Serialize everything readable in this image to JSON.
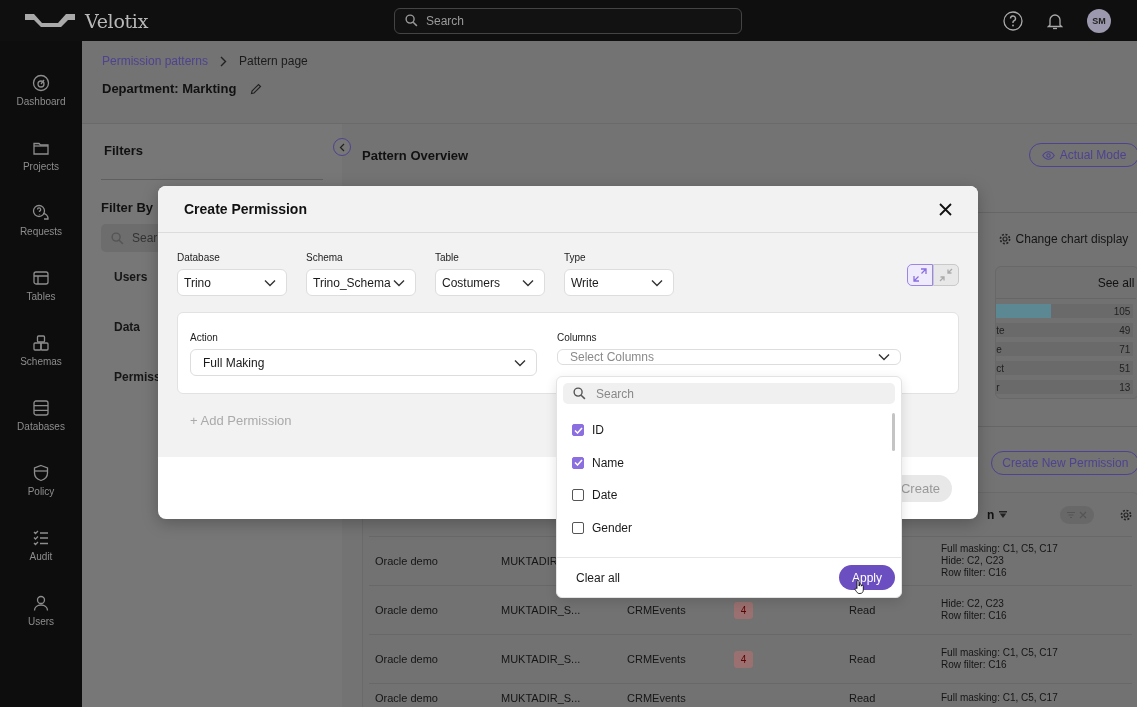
{
  "topbar": {
    "brand": "Velotix",
    "search": {
      "placeholder": "Search"
    },
    "avatar": "SM"
  },
  "sidebar": {
    "items": [
      {
        "label": "Dashboard"
      },
      {
        "label": "Projects"
      },
      {
        "label": "Requests"
      },
      {
        "label": "Tables"
      },
      {
        "label": "Schemas"
      },
      {
        "label": "Databases"
      },
      {
        "label": "Policy"
      },
      {
        "label": "Audit"
      },
      {
        "label": "Users"
      }
    ]
  },
  "breadcrumb": [
    {
      "label": "Permission patterns",
      "current": false
    },
    {
      "label": "Pattern page",
      "current": true
    }
  ],
  "page_title": "Department: Markting",
  "filters": {
    "title": "Filters",
    "filter_by": "Filter By",
    "search": {
      "placeholder": "Sear"
    },
    "groups": [
      "Users",
      "Data",
      "Permiss"
    ]
  },
  "overview": {
    "title": "Pattern Overview",
    "mode_button": "Actual Mode",
    "chart_display": "Change chart display",
    "chart_card": {
      "see_all": "See all",
      "rows": [
        {
          "value": "105",
          "level": 0.4
        },
        {
          "label": "te",
          "value": "49"
        },
        {
          "label": "e",
          "value": "71"
        },
        {
          "label": "ct",
          "value": "51"
        },
        {
          "label": "r",
          "value": "13"
        }
      ]
    },
    "create_button": "Create New Permission",
    "table": {
      "header": "n",
      "rows": [
        {
          "cells": [
            "Oracle demo",
            "MUKTADIR"
          ],
          "rules": [
            "Full masking: C1, C5, C17",
            "Hide: C2, C23",
            "Row filter: C16"
          ]
        },
        {
          "cells": [
            "Oracle demo",
            "MUKTADIR_S...",
            "CRMEvents"
          ],
          "count": "4",
          "type": "Read",
          "rules": [
            "Hide: C2, C23",
            "Row filter: C16"
          ]
        },
        {
          "cells": [
            "Oracle demo",
            "MUKTADIR_S...",
            "CRMEvents"
          ],
          "count": "4",
          "type": "Read",
          "rules": [
            "Full masking: C1, C5, C17",
            "Row filter: C16"
          ]
        },
        {
          "cells": [
            "Oracle demo",
            "MUKTADIR_S...",
            "CRMEvents"
          ],
          "type": "Read",
          "rules": [
            "Full masking: C1, C5, C17"
          ]
        }
      ]
    }
  },
  "modal": {
    "title": "Create Permission",
    "selects": [
      {
        "label": "Database",
        "value": "Trino"
      },
      {
        "label": "Schema",
        "value": "Trino_Schema"
      },
      {
        "label": "Table",
        "value": "Costumers"
      },
      {
        "label": "Type",
        "value": "Write"
      }
    ],
    "view_toggle": [
      {
        "selected": true
      },
      {
        "selected": false
      }
    ],
    "action": {
      "label": "Action",
      "value": "Full Making"
    },
    "columns": {
      "label": "Columns",
      "placeholder": "Select Columns"
    },
    "add_button": "+ Add Permission",
    "create_button": {
      "label": "Create",
      "disabled": true
    },
    "column_menu": {
      "search_placeholder": "Search",
      "options": [
        {
          "label": "ID",
          "checked": true
        },
        {
          "label": "Name",
          "checked": true
        },
        {
          "label": "Date",
          "checked": false
        },
        {
          "label": "Gender",
          "checked": false
        }
      ],
      "clear": "Clear all",
      "apply": "Apply"
    }
  }
}
